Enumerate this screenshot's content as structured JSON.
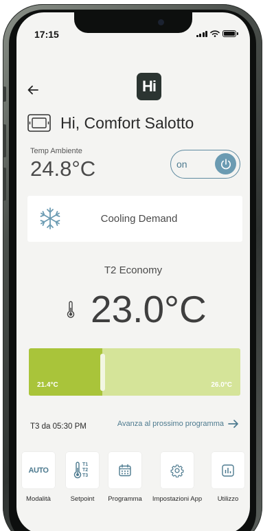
{
  "status_bar": {
    "time": "17:15"
  },
  "header": {
    "logo_text": "Hi",
    "back_icon": "arrow-left-icon"
  },
  "device": {
    "icon": "thermostat-device-icon",
    "greeting": "Hi, Comfort Salotto"
  },
  "ambient": {
    "label": "Temp Ambiente",
    "value": "24.8°C"
  },
  "power_toggle": {
    "label": "on",
    "state": true,
    "icon": "power-icon"
  },
  "demand": {
    "icon": "snowflake-icon",
    "text": "Cooling Demand"
  },
  "program": {
    "mode_label": "T2 Economy",
    "setpoint": "23.0°C",
    "icon": "thermometer-icon"
  },
  "slider": {
    "min_label": "21.4°C",
    "max_label": "26.0°C",
    "min": 21.4,
    "max": 26.0,
    "value": 23.0
  },
  "next": {
    "time_text": "T3 da 05:30 PM",
    "link_text": "Avanza al prossimo programma",
    "icon": "arrow-right-icon"
  },
  "tabs": [
    {
      "label": "Modalità",
      "icon_text": "AUTO",
      "icon": "auto-mode-icon"
    },
    {
      "label": "Setpoint",
      "icon_text": "T1 T2 T3",
      "icon": "thermometer-setpoint-icon"
    },
    {
      "label": "Programma",
      "icon": "calendar-icon"
    },
    {
      "label": "Impostazioni App",
      "icon": "gear-icon"
    },
    {
      "label": "Utilizzo",
      "icon": "usage-chart-icon"
    }
  ],
  "colors": {
    "accent": "#4d7a8f",
    "slider_fill": "#a9c43a",
    "slider_track": "#d5e499",
    "logo_bg": "#2b3431"
  }
}
